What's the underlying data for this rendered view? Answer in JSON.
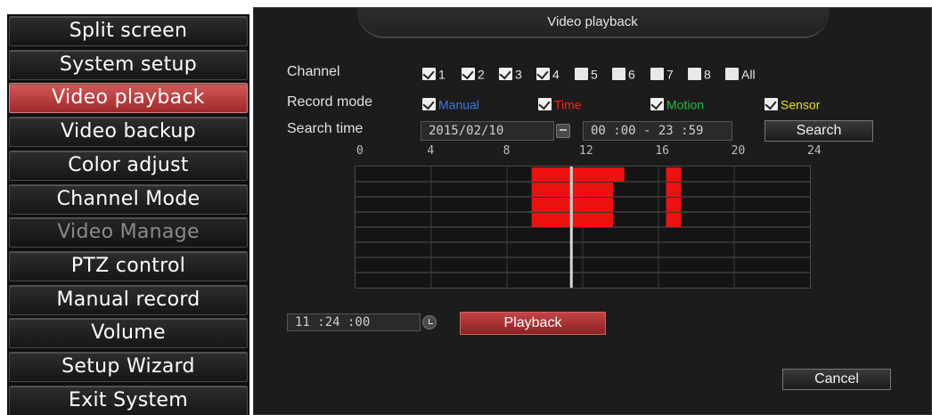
{
  "menu": [
    {
      "label": "Split screen",
      "state": "normal"
    },
    {
      "label": "System setup",
      "state": "normal"
    },
    {
      "label": "Video playback",
      "state": "active"
    },
    {
      "label": "Video backup",
      "state": "normal"
    },
    {
      "label": "Color adjust",
      "state": "normal"
    },
    {
      "label": "Channel Mode",
      "state": "normal"
    },
    {
      "label": "Video Manage",
      "state": "disabled"
    },
    {
      "label": "PTZ control",
      "state": "normal"
    },
    {
      "label": "Manual record",
      "state": "normal"
    },
    {
      "label": "Volume",
      "state": "normal"
    },
    {
      "label": "Setup Wizard",
      "state": "normal"
    },
    {
      "label": "Exit System",
      "state": "normal"
    }
  ],
  "window": {
    "title": "Video playback"
  },
  "form": {
    "channel_label": "Channel",
    "record_mode_label": "Record mode",
    "search_time_label": "Search time",
    "channels": [
      {
        "label": "1",
        "checked": true
      },
      {
        "label": "2",
        "checked": true
      },
      {
        "label": "3",
        "checked": true
      },
      {
        "label": "4",
        "checked": true
      },
      {
        "label": "5",
        "checked": false
      },
      {
        "label": "6",
        "checked": false
      },
      {
        "label": "7",
        "checked": false
      },
      {
        "label": "8",
        "checked": false
      },
      {
        "label": "All",
        "checked": false
      }
    ],
    "record_modes": [
      {
        "label": "Manual",
        "checked": true,
        "color": "#3a7be0"
      },
      {
        "label": "Time",
        "checked": true,
        "color": "#ff2020"
      },
      {
        "label": "Motion",
        "checked": true,
        "color": "#22c040"
      },
      {
        "label": "Sensor",
        "checked": true,
        "color": "#e8e020"
      }
    ],
    "date": "2015/02/10",
    "time_range": "00 :00  -  23 :59",
    "search_label": "Search"
  },
  "timeline": {
    "hour_ticks": [
      "0",
      "4",
      "8",
      "12",
      "16",
      "20",
      "24"
    ],
    "rows": 8,
    "cursor_hour": 11.4,
    "record_color": "#ee1111",
    "segments": [
      {
        "row": 0,
        "start": 9.3,
        "end": 14.2
      },
      {
        "row": 0,
        "start": 16.4,
        "end": 17.2
      },
      {
        "row": 1,
        "start": 9.3,
        "end": 13.6
      },
      {
        "row": 1,
        "start": 16.4,
        "end": 17.2
      },
      {
        "row": 2,
        "start": 9.3,
        "end": 13.6
      },
      {
        "row": 2,
        "start": 16.4,
        "end": 17.2
      },
      {
        "row": 3,
        "start": 9.3,
        "end": 13.6
      },
      {
        "row": 3,
        "start": 16.4,
        "end": 17.2
      }
    ]
  },
  "playback_time": "11 :24 :00",
  "playback_label": "Playback",
  "cancel_label": "Cancel"
}
